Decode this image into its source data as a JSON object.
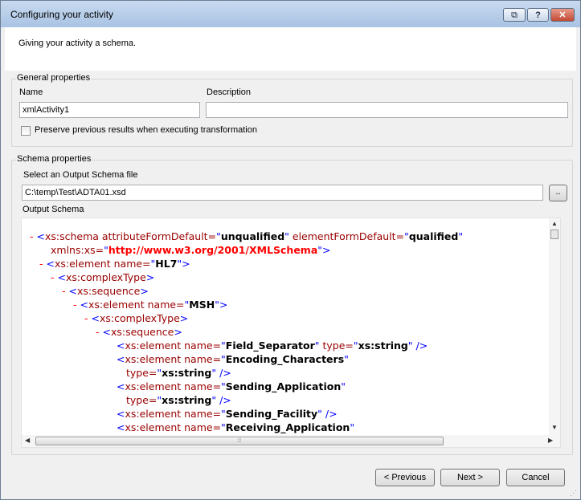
{
  "window": {
    "title": "Configuring your activity",
    "controls": {
      "restore": "⧉",
      "help": "?",
      "close": "✕"
    }
  },
  "header": {
    "text": "Giving your activity a schema."
  },
  "general": {
    "legend": "General properties",
    "name_label": "Name",
    "name_value": "xmlActivity1",
    "description_label": "Description",
    "description_value": "",
    "preserve_label": "Preserve previous results when executing transformation",
    "preserve_checked": false
  },
  "schema": {
    "legend": "Schema properties",
    "select_label": "Select an Output Schema file",
    "file_value": "C:\\temp\\Test\\ADTA01.xsd",
    "browse_label": "..",
    "output_label": "Output Schema",
    "xml_lines": [
      {
        "minus": "-",
        "segments": [
          {
            "c": "br",
            "t": "<"
          },
          {
            "c": "tag",
            "t": "xs:schema attributeFormDefault="
          },
          {
            "c": "br",
            "t": "\""
          },
          {
            "c": "val",
            "t": "unqualified"
          },
          {
            "c": "br",
            "t": "\""
          },
          {
            "c": "tag",
            "t": " elementFormDefault="
          },
          {
            "c": "br",
            "t": "\""
          },
          {
            "c": "val",
            "t": "qualified"
          },
          {
            "c": "br",
            "t": "\""
          }
        ]
      },
      {
        "minus": "",
        "segments": [
          {
            "c": "tag",
            "t": "xmlns:xs="
          },
          {
            "c": "br",
            "t": "\""
          },
          {
            "c": "url",
            "t": "http://www.w3.org/2001/XMLSchema"
          },
          {
            "c": "br",
            "t": "\">"
          }
        ]
      },
      {
        "minus": "-",
        "segments": [
          {
            "c": "br",
            "t": "<"
          },
          {
            "c": "tag",
            "t": "xs:element name="
          },
          {
            "c": "br",
            "t": "\""
          },
          {
            "c": "val",
            "t": "HL7"
          },
          {
            "c": "br",
            "t": "\">"
          }
        ]
      },
      {
        "minus": "-",
        "segments": [
          {
            "c": "br",
            "t": "<"
          },
          {
            "c": "tag",
            "t": "xs:complexType"
          },
          {
            "c": "br",
            "t": ">"
          }
        ]
      },
      {
        "minus": "-",
        "segments": [
          {
            "c": "br",
            "t": "<"
          },
          {
            "c": "tag",
            "t": "xs:sequence"
          },
          {
            "c": "br",
            "t": ">"
          }
        ]
      },
      {
        "minus": "-",
        "segments": [
          {
            "c": "br",
            "t": "<"
          },
          {
            "c": "tag",
            "t": "xs:element name="
          },
          {
            "c": "br",
            "t": "\""
          },
          {
            "c": "val",
            "t": "MSH"
          },
          {
            "c": "br",
            "t": "\">"
          }
        ]
      },
      {
        "minus": "-",
        "segments": [
          {
            "c": "br",
            "t": "<"
          },
          {
            "c": "tag",
            "t": "xs:complexType"
          },
          {
            "c": "br",
            "t": ">"
          }
        ]
      },
      {
        "minus": "-",
        "segments": [
          {
            "c": "br",
            "t": "<"
          },
          {
            "c": "tag",
            "t": "xs:sequence"
          },
          {
            "c": "br",
            "t": ">"
          }
        ]
      },
      {
        "minus": "",
        "segments": [
          {
            "c": "br",
            "t": "<"
          },
          {
            "c": "tag",
            "t": "xs:element name="
          },
          {
            "c": "br",
            "t": "\""
          },
          {
            "c": "val",
            "t": "Field_Separator"
          },
          {
            "c": "br",
            "t": "\""
          },
          {
            "c": "tag",
            "t": " type="
          },
          {
            "c": "br",
            "t": "\""
          },
          {
            "c": "val",
            "t": "xs:string"
          },
          {
            "c": "br",
            "t": "\" />"
          }
        ]
      },
      {
        "minus": "",
        "segments": [
          {
            "c": "br",
            "t": "<"
          },
          {
            "c": "tag",
            "t": "xs:element name="
          },
          {
            "c": "br",
            "t": "\""
          },
          {
            "c": "val",
            "t": "Encoding_Characters"
          },
          {
            "c": "br",
            "t": "\""
          }
        ]
      },
      {
        "minus": "",
        "segments": [
          {
            "c": "tag",
            "t": "type="
          },
          {
            "c": "br",
            "t": "\""
          },
          {
            "c": "val",
            "t": "xs:string"
          },
          {
            "c": "br",
            "t": "\" />"
          }
        ]
      },
      {
        "minus": "",
        "segments": [
          {
            "c": "br",
            "t": "<"
          },
          {
            "c": "tag",
            "t": "xs:element name="
          },
          {
            "c": "br",
            "t": "\""
          },
          {
            "c": "val",
            "t": "Sending_Application"
          },
          {
            "c": "br",
            "t": "\""
          }
        ]
      },
      {
        "minus": "",
        "segments": [
          {
            "c": "tag",
            "t": "type="
          },
          {
            "c": "br",
            "t": "\""
          },
          {
            "c": "val",
            "t": "xs:string"
          },
          {
            "c": "br",
            "t": "\" />"
          }
        ]
      },
      {
        "minus": "",
        "segments": [
          {
            "c": "br",
            "t": "<"
          },
          {
            "c": "tag",
            "t": "xs:element name="
          },
          {
            "c": "br",
            "t": "\""
          },
          {
            "c": "val",
            "t": "Sending_Facility"
          },
          {
            "c": "br",
            "t": "\" />"
          }
        ]
      },
      {
        "minus": "",
        "segments": [
          {
            "c": "br",
            "t": "<"
          },
          {
            "c": "tag",
            "t": "xs:element name="
          },
          {
            "c": "br",
            "t": "\""
          },
          {
            "c": "val",
            "t": "Receiving_Application"
          },
          {
            "c": "br",
            "t": "\""
          }
        ]
      }
    ]
  },
  "buttons": {
    "previous": "< Previous",
    "next": "Next >",
    "cancel": "Cancel"
  },
  "colors": {
    "minus": "#ff0000",
    "bracket": "#0000ff",
    "tag": "#990000",
    "url": "#ff0000"
  }
}
